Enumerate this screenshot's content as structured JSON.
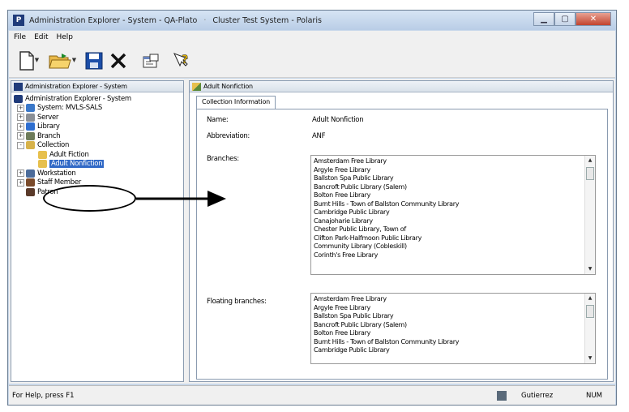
{
  "window": {
    "title_main": "Administration Explorer - System - QA-Plato",
    "title_sub": "Cluster Test System - Polaris",
    "app_icon_letter": "P"
  },
  "menu": [
    "File",
    "Edit",
    "Help"
  ],
  "toolbar": {
    "icons": [
      "new-icon",
      "open-folder-icon",
      "save-icon",
      "delete-icon",
      "properties-icon",
      "help-icon"
    ]
  },
  "left_pane": {
    "header": "Administration Explorer - System",
    "tree": [
      {
        "label": "Administration Explorer - System",
        "icon": "polaris-icon",
        "level": 0,
        "expander": ""
      },
      {
        "label": "System: MVLS-SALS",
        "icon": "system-icon",
        "level": 1,
        "expander": "+"
      },
      {
        "label": "Server",
        "icon": "server-icon",
        "level": 1,
        "expander": "+"
      },
      {
        "label": "Library",
        "icon": "library-icon",
        "level": 1,
        "expander": "+"
      },
      {
        "label": "Branch",
        "icon": "branch-icon",
        "level": 1,
        "expander": "+"
      },
      {
        "label": "Collection",
        "icon": "collection-icon",
        "level": 1,
        "expander": "-"
      },
      {
        "label": "Adult Fiction",
        "icon": "collection-item-icon",
        "level": 2,
        "expander": ""
      },
      {
        "label": "Adult Nonfiction",
        "icon": "collection-item-icon",
        "level": 2,
        "expander": "",
        "selected": true
      },
      {
        "label": "Workstation",
        "icon": "workstation-icon",
        "level": 1,
        "expander": "+"
      },
      {
        "label": "Staff Member",
        "icon": "staff-icon",
        "level": 1,
        "expander": "+"
      },
      {
        "label": "Patron",
        "icon": "patron-icon",
        "level": 1,
        "expander": ""
      }
    ]
  },
  "right_pane": {
    "header": "Adult Nonfiction",
    "tab": "Collection Information",
    "name_label": "Name:",
    "name_value": "Adult Nonfiction",
    "abbr_label": "Abbreviation:",
    "abbr_value": "ANF",
    "branches_label": "Branches:",
    "branches": [
      "Amsterdam Free Library",
      "Argyle Free Library",
      "Ballston Spa Public Library",
      "Bancroft Public Library (Salem)",
      "Bolton Free Library",
      "Burnt Hills - Town of Ballston Community Library",
      "Cambridge Public Library",
      "Canajoharie Library",
      "Chester Public Library, Town of",
      "Clifton Park-Halfmoon Public Library",
      "Community Library (Cobleskill)",
      "Corinth's Free Library"
    ],
    "floating_label": "Floating branches:",
    "floating_branches": [
      "Amsterdam Free Library",
      "Argyle Free Library",
      "Ballston Spa Public Library",
      "Bancroft Public Library (Salem)",
      "Bolton Free Library",
      "Burnt Hills - Town of Ballston Community Library",
      "Cambridge Public Library"
    ]
  },
  "status": {
    "message": "For Help, press F1",
    "user": "Gutierrez",
    "num": "NUM"
  },
  "colors": {
    "selection": "#3169c6",
    "titlebar": "#c9d8ea",
    "close_button": "#c2432e"
  }
}
